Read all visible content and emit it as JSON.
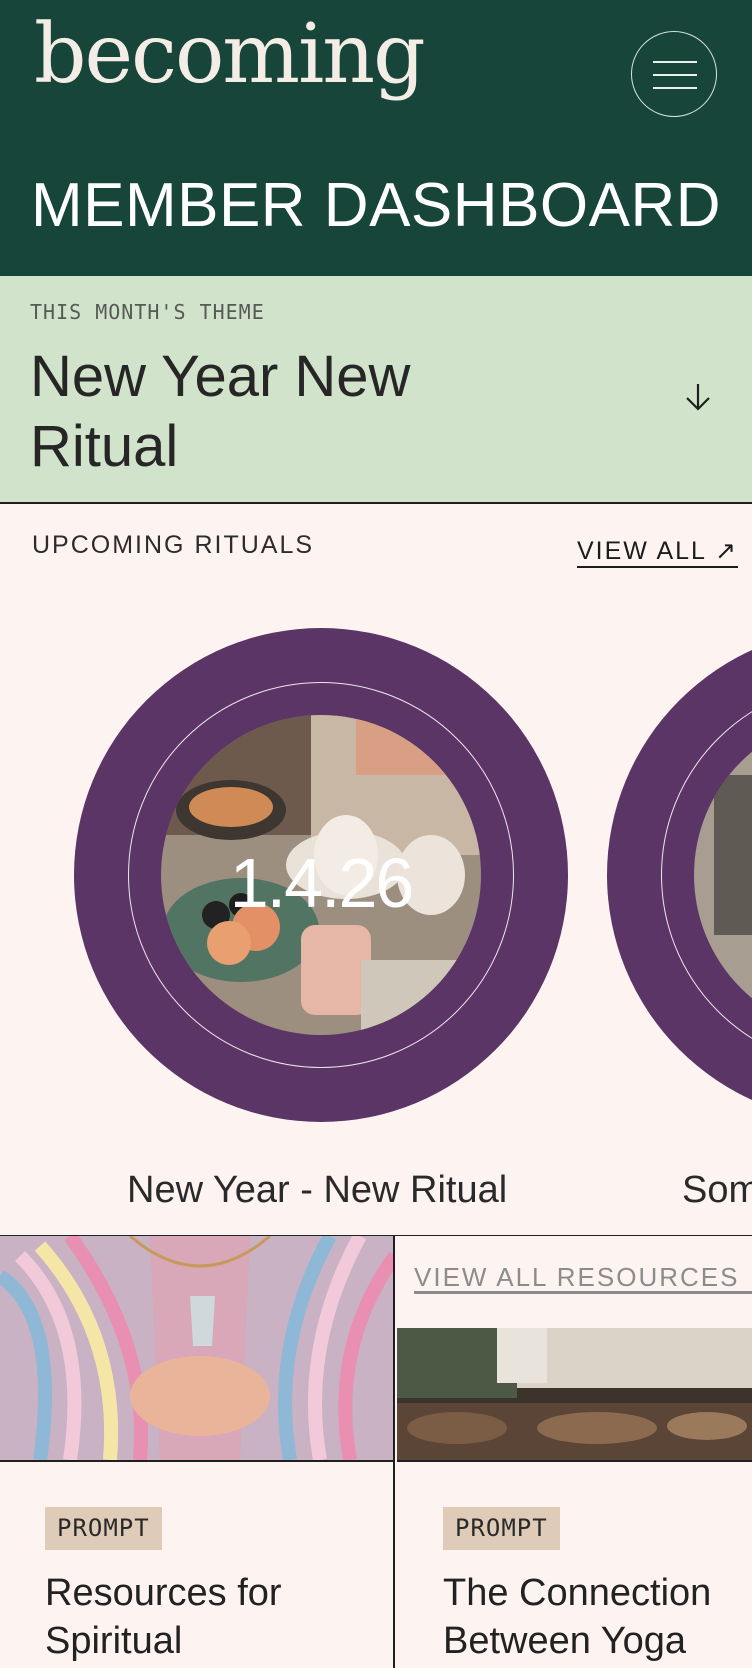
{
  "header": {
    "logo": "becoming",
    "menu_icon": "hamburger-menu-icon",
    "title": "MEMBER DASHBOARD"
  },
  "theme": {
    "eyebrow": "THIS MONTH'S THEME",
    "title": "New Year New Ritual",
    "toggle_icon": "arrow-down-icon"
  },
  "rituals": {
    "heading": "UPCOMING RITUALS",
    "view_all": "VIEW ALL ↗",
    "items": [
      {
        "date": "1.4.26",
        "title": "New Year - New Ritual"
      },
      {
        "date": "",
        "title": "Som"
      }
    ]
  },
  "resources": {
    "view_all": "VIEW ALL RESOURCES ↗",
    "cards": [
      {
        "tag": "PROMPT",
        "title": "Resources for Spiritual"
      },
      {
        "tag": "PROMPT",
        "title": "The Connection Between Yoga"
      }
    ]
  },
  "colors": {
    "header_bg": "#17453a",
    "theme_bg": "#d2e3cb",
    "page_bg": "#fdf4f2",
    "ring": "#5b3566",
    "tag_bg": "#dfccb8"
  }
}
